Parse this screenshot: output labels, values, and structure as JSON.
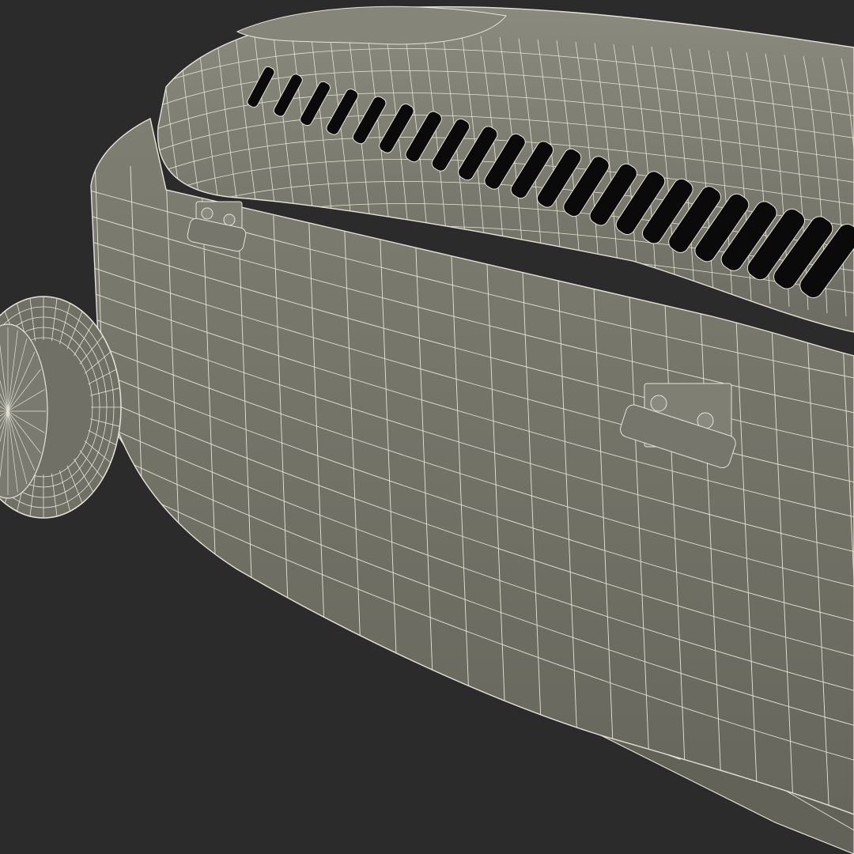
{
  "scene": {
    "subject": "grill-wireframe-model",
    "background_color": "#2b2b2b",
    "surface_color": "#7a7a6e",
    "surface_shadow_color": "#5c5c53",
    "wire_color": "#e6e4d6",
    "vent_color": "#0a0a0a",
    "vent_count": 22,
    "hinge_count": 2,
    "wheel_count": 1
  }
}
